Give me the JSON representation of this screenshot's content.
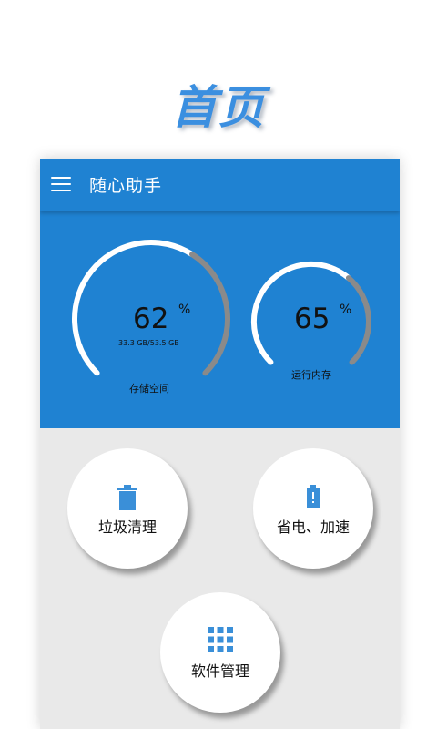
{
  "promo": {
    "title": "首页"
  },
  "appbar": {
    "title": "随心助手",
    "menu_icon": "hamburger-menu-icon"
  },
  "storage_gauge": {
    "percent": "62",
    "unit": "%",
    "detail": "33.3 GB/53.5 GB",
    "label": "存储空间",
    "fraction": 0.62
  },
  "memory_gauge": {
    "percent": "65",
    "unit": "%",
    "label": "运行内存",
    "fraction": 0.65
  },
  "actions": {
    "clean": {
      "label": "垃圾清理",
      "icon": "trash-icon"
    },
    "battery": {
      "label": "省电、加速",
      "icon": "battery-icon"
    },
    "apps": {
      "label": "软件管理",
      "icon": "grid-icon"
    }
  },
  "colors": {
    "primary": "#1f82d2",
    "icon_blue": "#3a8fd8",
    "arc_white": "#ffffff",
    "arc_gray": "#8a8a8a"
  }
}
